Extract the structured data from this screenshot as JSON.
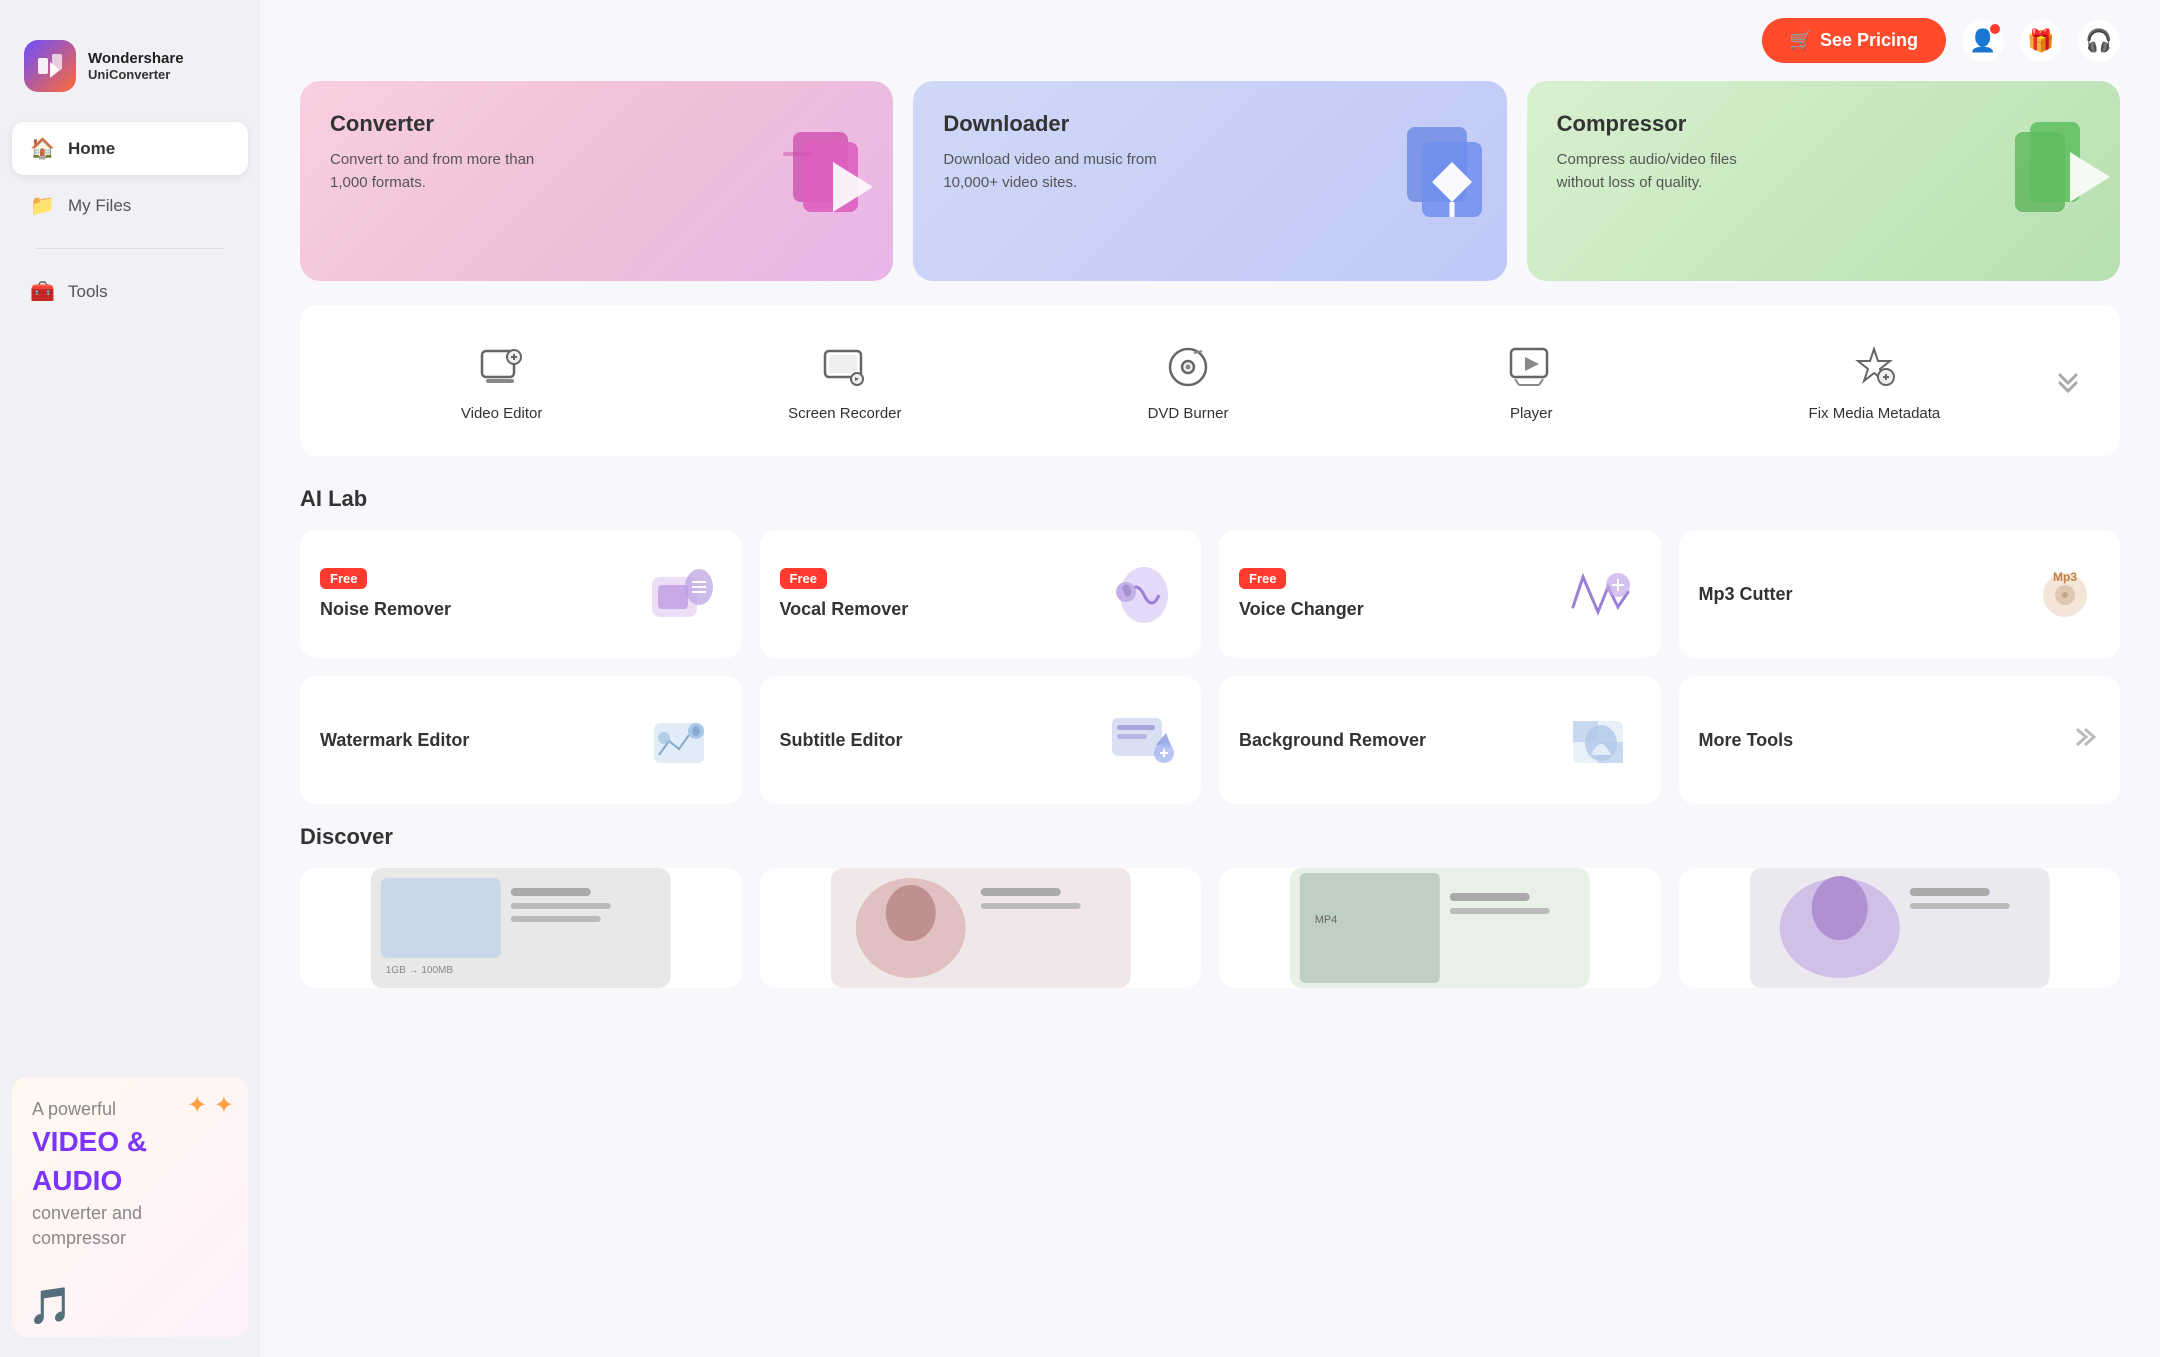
{
  "app": {
    "name": "Wondershare",
    "product": "UniConverter"
  },
  "header": {
    "pricing_label": "See Pricing",
    "pricing_icon": "🛒"
  },
  "sidebar": {
    "nav_items": [
      {
        "id": "home",
        "label": "Home",
        "icon": "🏠",
        "active": true
      },
      {
        "id": "my-files",
        "label": "My Files",
        "icon": "📁",
        "active": false
      },
      {
        "id": "tools",
        "label": "Tools",
        "icon": "🧰",
        "active": false
      }
    ]
  },
  "banner": {
    "line1": "A powerful",
    "highlight1": "VIDEO &",
    "highlight2": "AUDIO",
    "line2": "converter and",
    "line3": "compressor"
  },
  "feature_cards": [
    {
      "id": "converter",
      "title": "Converter",
      "description": "Convert to and from more than 1,000 formats.",
      "theme": "converter"
    },
    {
      "id": "downloader",
      "title": "Downloader",
      "description": "Download video and music from 10,000+ video sites.",
      "theme": "downloader"
    },
    {
      "id": "compressor",
      "title": "Compressor",
      "description": "Compress audio/video files without loss of quality.",
      "theme": "compressor"
    }
  ],
  "tools": [
    {
      "id": "video-editor",
      "label": "Video Editor",
      "icon": "✂"
    },
    {
      "id": "screen-recorder",
      "label": "Screen Recorder",
      "icon": "🖥"
    },
    {
      "id": "dvd-burner",
      "label": "DVD Burner",
      "icon": "💿"
    },
    {
      "id": "player",
      "label": "Player",
      "icon": "📺"
    },
    {
      "id": "fix-media-metadata",
      "label": "Fix Media Metadata",
      "icon": "🔧"
    }
  ],
  "ai_lab": {
    "title": "AI Lab",
    "row1": [
      {
        "id": "noise-remover",
        "label": "Noise Remover",
        "free": true,
        "badge": "Free"
      },
      {
        "id": "vocal-remover",
        "label": "Vocal Remover",
        "free": true,
        "badge": "Free"
      },
      {
        "id": "voice-changer",
        "label": "Voice Changer",
        "free": true,
        "badge": "Free"
      },
      {
        "id": "mp3-cutter",
        "label": "Mp3 Cutter",
        "free": false,
        "badge": ""
      }
    ],
    "row2": [
      {
        "id": "watermark-editor",
        "label": "Watermark Editor",
        "free": false,
        "badge": ""
      },
      {
        "id": "subtitle-editor",
        "label": "Subtitle Editor",
        "free": false,
        "badge": ""
      },
      {
        "id": "background-remover",
        "label": "Background Remover",
        "free": false,
        "badge": ""
      },
      {
        "id": "more-tools",
        "label": "More Tools",
        "is_more": true
      }
    ]
  },
  "discover": {
    "title": "Discover",
    "cards": [
      {
        "id": "discover-1",
        "label": ""
      },
      {
        "id": "discover-2",
        "label": ""
      },
      {
        "id": "discover-3",
        "label": ""
      },
      {
        "id": "discover-4",
        "label": ""
      }
    ]
  },
  "colors": {
    "accent_red": "#FF3B30",
    "accent_purple": "#7B35FF",
    "converter_bg": "#f2c4d8",
    "downloader_bg": "#c8d0f8",
    "compressor_bg": "#c8e8b8"
  }
}
